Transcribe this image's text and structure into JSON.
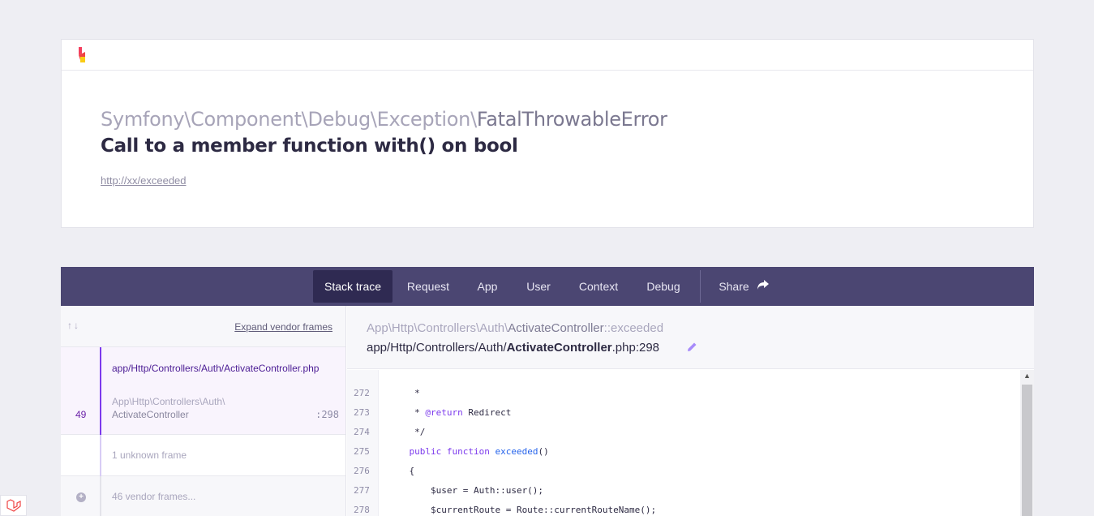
{
  "header": {
    "exception_namespace": "Symfony\\Component\\Debug\\Exception\\",
    "exception_class": "FatalThrowableError",
    "message": "Call to a member function with() on bool",
    "url": "http://xx/exceeded"
  },
  "tabs": [
    {
      "label": "Stack trace",
      "active": true
    },
    {
      "label": "Request"
    },
    {
      "label": "App"
    },
    {
      "label": "User"
    },
    {
      "label": "Context"
    },
    {
      "label": "Debug"
    },
    {
      "label": "Share"
    }
  ],
  "frames_panel": {
    "sort_arrows": "↑↓",
    "expand_label": "Expand vendor frames",
    "active_frame": {
      "number": "49",
      "file": "app/Http/Controllers/Auth/ActivateController.php",
      "class_namespace": "App\\Http\\Controllers\\Auth\\",
      "class_name": "ActivateController",
      "line": ":298"
    },
    "unknown_frame": "1 unknown frame",
    "vendor_frames": "46 vendor frames..."
  },
  "code_panel": {
    "class_namespace": "App\\Http\\Controllers\\Auth\\",
    "class_name": "ActivateController",
    "method": "::exceeded",
    "file_path": "app/Http/Controllers/Auth/",
    "file_name": "ActivateController",
    "file_ext_line": ".php:298",
    "lines": [
      {
        "number": "272",
        "text": "     *"
      },
      {
        "number": "273",
        "text": "     * @return Redirect"
      },
      {
        "number": "274",
        "text": "     */"
      },
      {
        "number": "275",
        "text": "    public function exceeded()"
      },
      {
        "number": "276",
        "text": "    {"
      },
      {
        "number": "277",
        "text": "        $user = Auth::user();"
      },
      {
        "number": "278",
        "text": "        $currentRoute = Route::currentRouteName();"
      }
    ]
  },
  "colors": {
    "tab_bar": "#4b4672",
    "tab_active": "#2f2a52",
    "accent": "#7c3aed"
  }
}
